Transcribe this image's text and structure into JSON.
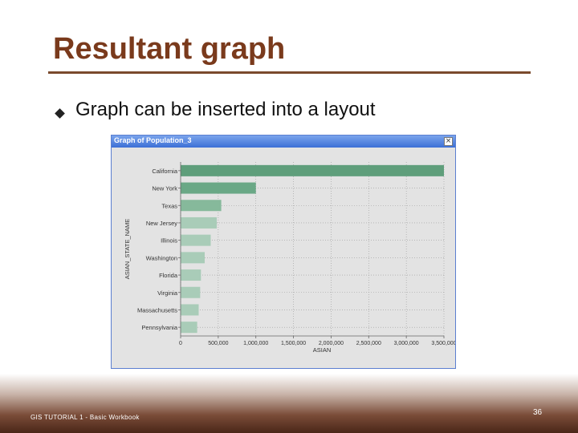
{
  "slide": {
    "title": "Resultant graph",
    "bullet": "Graph can be inserted into a layout"
  },
  "window": {
    "title": "Graph of Population_3",
    "close_glyph": "×"
  },
  "footer": {
    "left_text": "GIS TUTORIAL 1 - Basic Workbook",
    "page_number": "36"
  },
  "colors": {
    "title": "#7a3a1c",
    "accent_rule": "#7a4a2c",
    "bar_top": "#5f9e7b",
    "bar_light": "#a9ccb8",
    "plot_bg": "#e3e3e3",
    "titlebar": "#3c6fd6"
  },
  "chart_data": {
    "type": "bar",
    "orientation": "horizontal",
    "categories": [
      "California",
      "New York",
      "Texas",
      "New Jersey",
      "Illinois",
      "Washington",
      "Florida",
      "Virginia",
      "Massachusetts",
      "Pennsylvania"
    ],
    "values": [
      3500000,
      1000000,
      540000,
      480000,
      400000,
      320000,
      270000,
      260000,
      240000,
      220000
    ],
    "xlabel": "ASIAN",
    "ylabel": "ASIAN_STATE_NAME",
    "xlim": [
      0,
      3500000
    ],
    "xticks": [
      "0",
      "500,000",
      "1,000,000",
      "1,500,000",
      "2,000,000",
      "2,500,000",
      "3,000,000",
      "3,500,000"
    ],
    "grid": true
  }
}
